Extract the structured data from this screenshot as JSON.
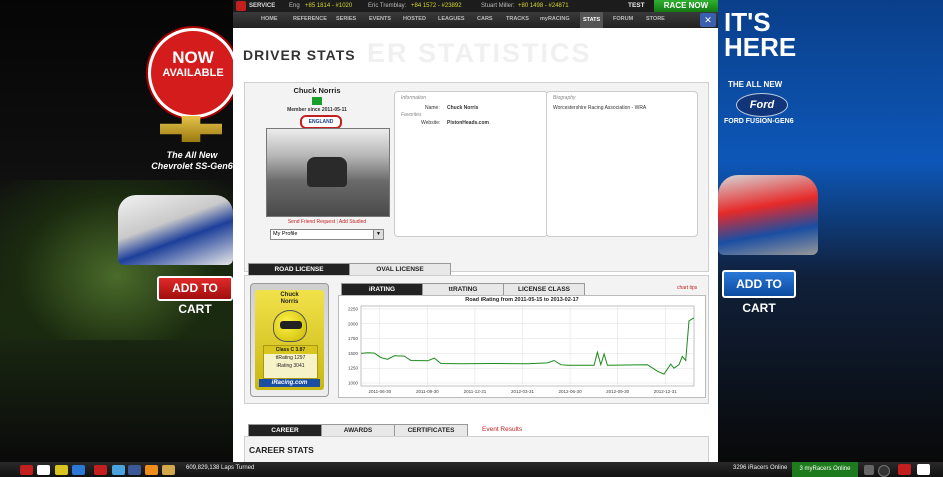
{
  "left_ad": {
    "badge_line1": "NOW",
    "badge_line2": "AVAILABLE",
    "tagline1": "The All New",
    "tagline2": "Chevrolet SS-Gen6",
    "cta": "ADD TO CART"
  },
  "right_ad": {
    "headline1": "IT'S",
    "headline2": "HERE",
    "sub1": "THE ALL NEW",
    "brand": "Ford",
    "model": "FORD FUSION-GEN6",
    "cta": "ADD TO CART"
  },
  "topbar": {
    "service": "SERVICE",
    "tickers": [
      {
        "name": "Eng",
        "value": "+85 1814 - #1020"
      },
      {
        "name": "Eric Tremblay:",
        "value": "+84 1572 - #23892"
      },
      {
        "name": "Stuart Miller:",
        "value": "+80 1498 - #24871"
      }
    ],
    "test": "TEST",
    "race_now": "RACE NOW"
  },
  "nav": [
    "HOME",
    "REFERENCE",
    "SERIES",
    "EVENTS",
    "HOSTED",
    "LEAGUES",
    "CARS",
    "TRACKS",
    "myRACING",
    "STATS",
    "FORUM",
    "STORE"
  ],
  "page": {
    "title": "DRIVER STATS",
    "watermark": "ER STATISTICS"
  },
  "profile": {
    "name": "Chuck Norris",
    "member_since": "Member since 2011-05-11",
    "country": "ENGLAND",
    "send_friend": "Send Friend Request",
    "separator": "|",
    "add_studied": "Add Studied",
    "select_value": "My Profile",
    "info_header": "Information",
    "name_label": "Name:",
    "name_value": "Chuck Norris",
    "favorites_header": "Favorites",
    "website_label": "Website:",
    "website_value": "PistonHeads.com",
    "bio_header": "Biography",
    "bio_text": "Worcestershire Racing Association - WRA"
  },
  "license_tabs": [
    "ROAD LICENSE",
    "OVAL LICENSE"
  ],
  "license_card": {
    "name1": "Chuck",
    "name2": "Norris",
    "class": "Class C 3.87",
    "ttrating": "ttRating 1297",
    "irating": "iRating 3041",
    "logo": "iRacing.com"
  },
  "stat_tabs": [
    "iRATING",
    "ttRATING",
    "LICENSE CLASS"
  ],
  "chart_tips": "chart tips",
  "chart_data": {
    "type": "line",
    "title": "Road iRating from 2011-05-15 to 2013-02-17",
    "yticks": [
      1000,
      1250,
      1500,
      1750,
      2000,
      2250
    ],
    "xticks": [
      "2011-06-30",
      "2011-09-30",
      "2011-12-31",
      "2012-03-31",
      "2012-06-30",
      "2012-09-30",
      "2012-12-31"
    ],
    "ylim": [
      950,
      2300
    ],
    "color": "#1c8a1c",
    "points": [
      [
        0.0,
        1500
      ],
      [
        0.02,
        1510
      ],
      [
        0.04,
        1505
      ],
      [
        0.06,
        1430
      ],
      [
        0.08,
        1400
      ],
      [
        0.1,
        1460
      ],
      [
        0.13,
        1455
      ],
      [
        0.15,
        1380
      ],
      [
        0.2,
        1375
      ],
      [
        0.22,
        1420
      ],
      [
        0.24,
        1330
      ],
      [
        0.3,
        1325
      ],
      [
        0.4,
        1330
      ],
      [
        0.5,
        1325
      ],
      [
        0.56,
        1340
      ],
      [
        0.58,
        1380
      ],
      [
        0.6,
        1310
      ],
      [
        0.62,
        1300
      ],
      [
        0.7,
        1300
      ],
      [
        0.71,
        1520
      ],
      [
        0.72,
        1310
      ],
      [
        0.73,
        1490
      ],
      [
        0.74,
        1300
      ],
      [
        0.8,
        1305
      ],
      [
        0.86,
        1310
      ],
      [
        0.89,
        1200
      ],
      [
        0.91,
        1150
      ],
      [
        0.93,
        1320
      ],
      [
        0.94,
        1250
      ],
      [
        0.955,
        1310
      ],
      [
        0.965,
        1450
      ],
      [
        0.975,
        1380
      ],
      [
        0.985,
        2050
      ],
      [
        1.0,
        2100
      ]
    ]
  },
  "bottom_tabs": [
    "CAREER",
    "AWARDS",
    "CERTIFICATES"
  ],
  "event_results": "Event Results",
  "career_title": "CAREER STATS",
  "footer": {
    "laps": "609,829,138 Laps Turned",
    "online": "3296 iRacers Online",
    "my_online": "3 myRacers Online"
  }
}
